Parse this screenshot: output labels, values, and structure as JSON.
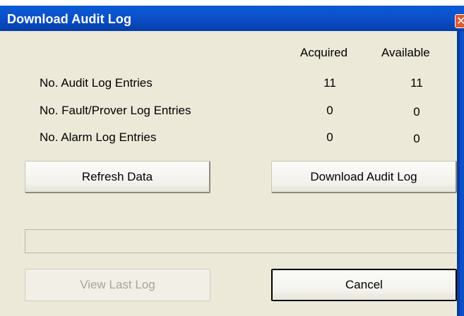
{
  "window": {
    "title": "Download Audit Log",
    "close_glyph": "✕",
    "close_icon": "close-icon"
  },
  "columns": {
    "acquired": "Acquired",
    "available": "Available"
  },
  "rows": [
    {
      "label": "No. Audit Log Entries",
      "acquired": "11",
      "available": "11"
    },
    {
      "label": "No. Fault/Prover Log Entries",
      "acquired": "0",
      "available": "0"
    },
    {
      "label": "No. Alarm Log Entries",
      "acquired": "0",
      "available": "0"
    }
  ],
  "buttons": {
    "refresh": "Refresh Data",
    "download": "Download Audit Log",
    "view_last": "View Last Log",
    "cancel": "Cancel"
  },
  "progress": {
    "value": 0
  },
  "colors": {
    "titlebar": "#0b4fc9",
    "body": "#ece9d8",
    "close": "#e3582f",
    "disabled_text": "#a7a69a"
  }
}
